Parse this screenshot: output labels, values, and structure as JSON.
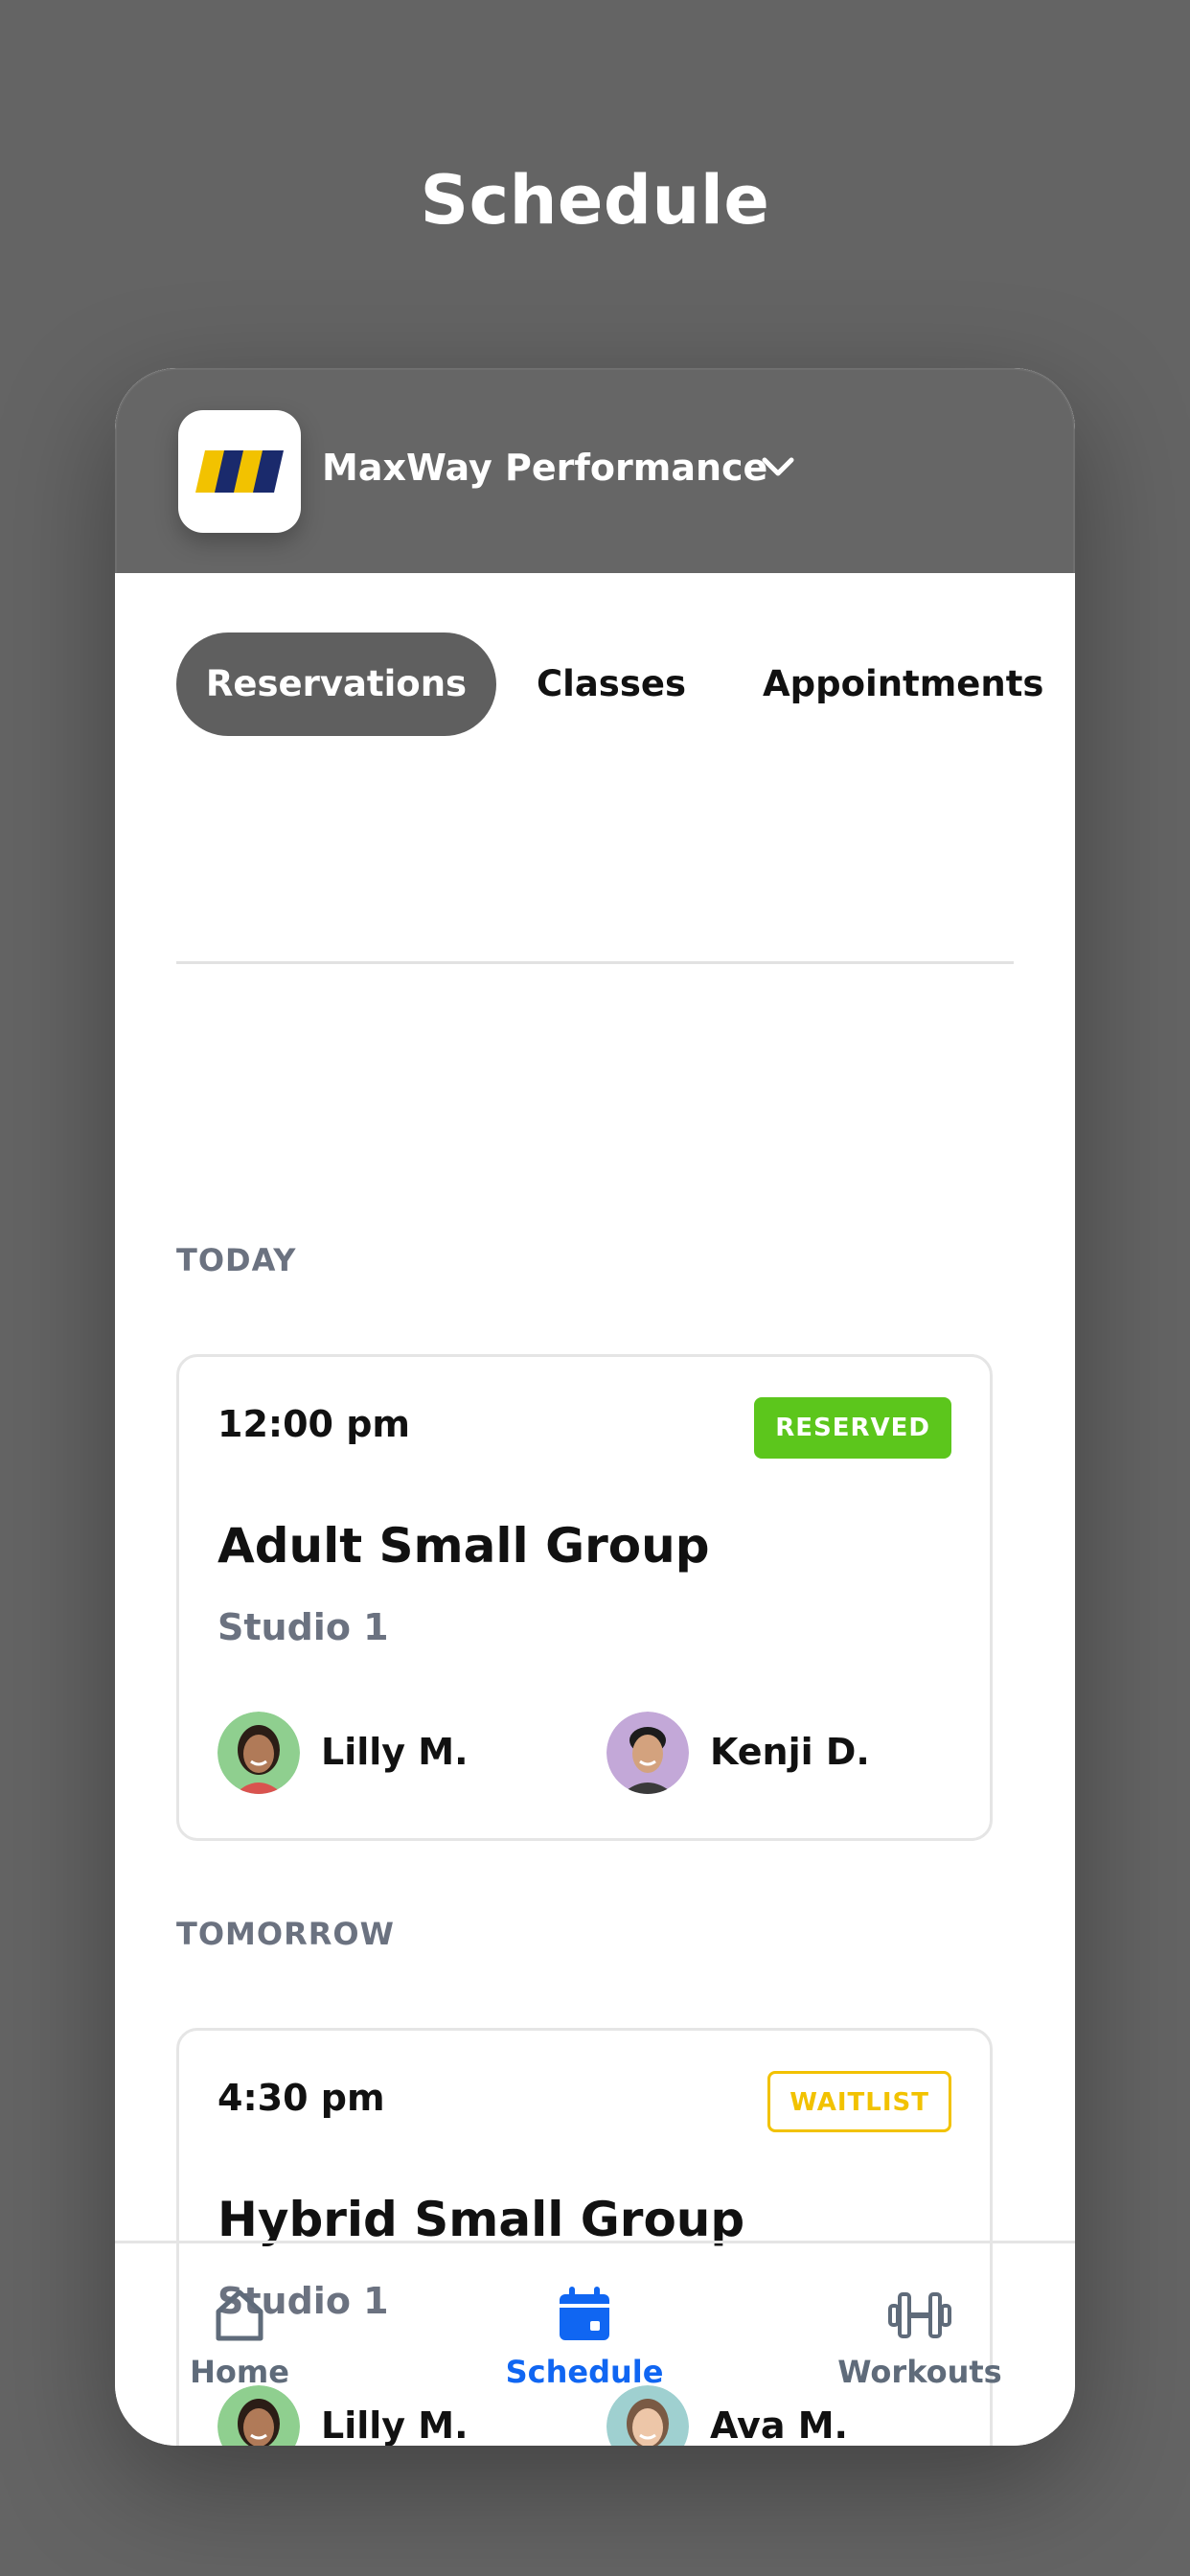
{
  "page": {
    "title": "Schedule"
  },
  "brand": {
    "name": "MaxWay Performance",
    "logo_icon": "maxway-logo"
  },
  "tabs": [
    {
      "label": "Reservations",
      "active": true
    },
    {
      "label": "Classes",
      "active": false
    },
    {
      "label": "Appointments",
      "active": false
    }
  ],
  "sections": [
    {
      "label": "TODAY",
      "card": {
        "time": "12:00 pm",
        "status": "RESERVED",
        "title": "Adult Small Group",
        "location": "Studio 1",
        "participants": [
          {
            "name": "Lilly M.",
            "avatar_bg": "#8fcf8f"
          },
          {
            "name": "Kenji D.",
            "avatar_bg": "#c3a8d8"
          }
        ]
      }
    },
    {
      "label": "TOMORROW",
      "card": {
        "time": "4:30 pm",
        "status": "WAITLIST",
        "title": "Hybrid Small Group",
        "location": "Studio 1",
        "participants": [
          {
            "name": "Lilly M.",
            "avatar_bg": "#8fcf8f"
          },
          {
            "name": "Ava M.",
            "avatar_bg": "#9fd0d0"
          }
        ]
      }
    }
  ],
  "nav": [
    {
      "label": "Home",
      "icon": "home-icon",
      "active": false
    },
    {
      "label": "Schedule",
      "icon": "calendar-icon",
      "active": true
    },
    {
      "label": "Workouts",
      "icon": "dumbbell-icon",
      "active": false
    }
  ],
  "colors": {
    "background": "#646464",
    "header": "#666666",
    "accent": "#1066f2",
    "reserved": "#5cc61c",
    "waitlist": "#f2c200"
  }
}
